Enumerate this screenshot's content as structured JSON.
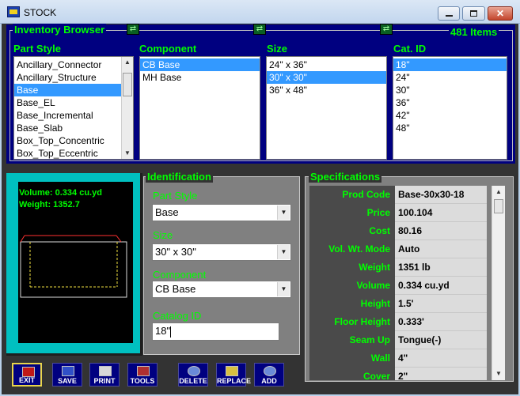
{
  "window": {
    "title": "STOCK"
  },
  "browser": {
    "title": "Inventory Browser",
    "items_count": "481 Items",
    "columns": {
      "part_style": {
        "header": "Part Style",
        "items": [
          "Ancillary_Connector",
          "Ancillary_Structure",
          "Base",
          "Base_EL",
          "Base_Incremental",
          "Base_Slab",
          "Box_Top_Concentric",
          "Box_Top_Eccentric"
        ],
        "selected": "Base"
      },
      "component": {
        "header": "Component",
        "items": [
          "CB Base",
          "MH Base"
        ],
        "selected": "CB Base"
      },
      "size": {
        "header": "Size",
        "items": [
          "24\" x 36\"",
          "30\" x 30\"",
          "36\" x 48\""
        ],
        "selected": "30\" x 30\""
      },
      "cat_id": {
        "header": "Cat. ID",
        "items": [
          "18\"",
          "24\"",
          "30\"",
          "36\"",
          "42\"",
          "48\""
        ],
        "selected": "18\""
      }
    }
  },
  "preview": {
    "volume": "Volume: 0.334 cu.yd",
    "weight": "Weight: 1352.7"
  },
  "identification": {
    "title": "Identification",
    "part_style_label": "Part Style",
    "part_style_value": "Base",
    "size_label": "Size",
    "size_value": "30\" x 30\"",
    "component_label": "Component",
    "component_value": "CB Base",
    "catalog_label": "Catalog ID",
    "catalog_value": "18\""
  },
  "specifications": {
    "title": "Specifications",
    "rows": [
      {
        "label": "Prod Code",
        "value": "Base-30x30-18"
      },
      {
        "label": "Price",
        "value": "100.104"
      },
      {
        "label": "Cost",
        "value": "80.16"
      },
      {
        "label": "Vol. Wt. Mode",
        "value": "Auto"
      },
      {
        "label": "Weight",
        "value": "1351 lb"
      },
      {
        "label": "Volume",
        "value": "0.334 cu.yd"
      },
      {
        "label": "Height",
        "value": "1.5'"
      },
      {
        "label": "Floor Height",
        "value": "0.333'"
      },
      {
        "label": "Seam Up",
        "value": "Tongue(-)"
      },
      {
        "label": "Wall",
        "value": "4\""
      },
      {
        "label": "Cover",
        "value": "2\""
      }
    ]
  },
  "toolbar": {
    "exit": "EXIT",
    "save": "SAVE",
    "print": "PRINT",
    "tools": "TOOLS",
    "delete": "DELETE",
    "replace": "REPLACE",
    "add": "ADD"
  },
  "colors": {
    "accent_green": "#00ff00",
    "panel_navy": "#000080",
    "selection_blue": "#3399ff",
    "preview_cyan": "#00c0c0"
  }
}
